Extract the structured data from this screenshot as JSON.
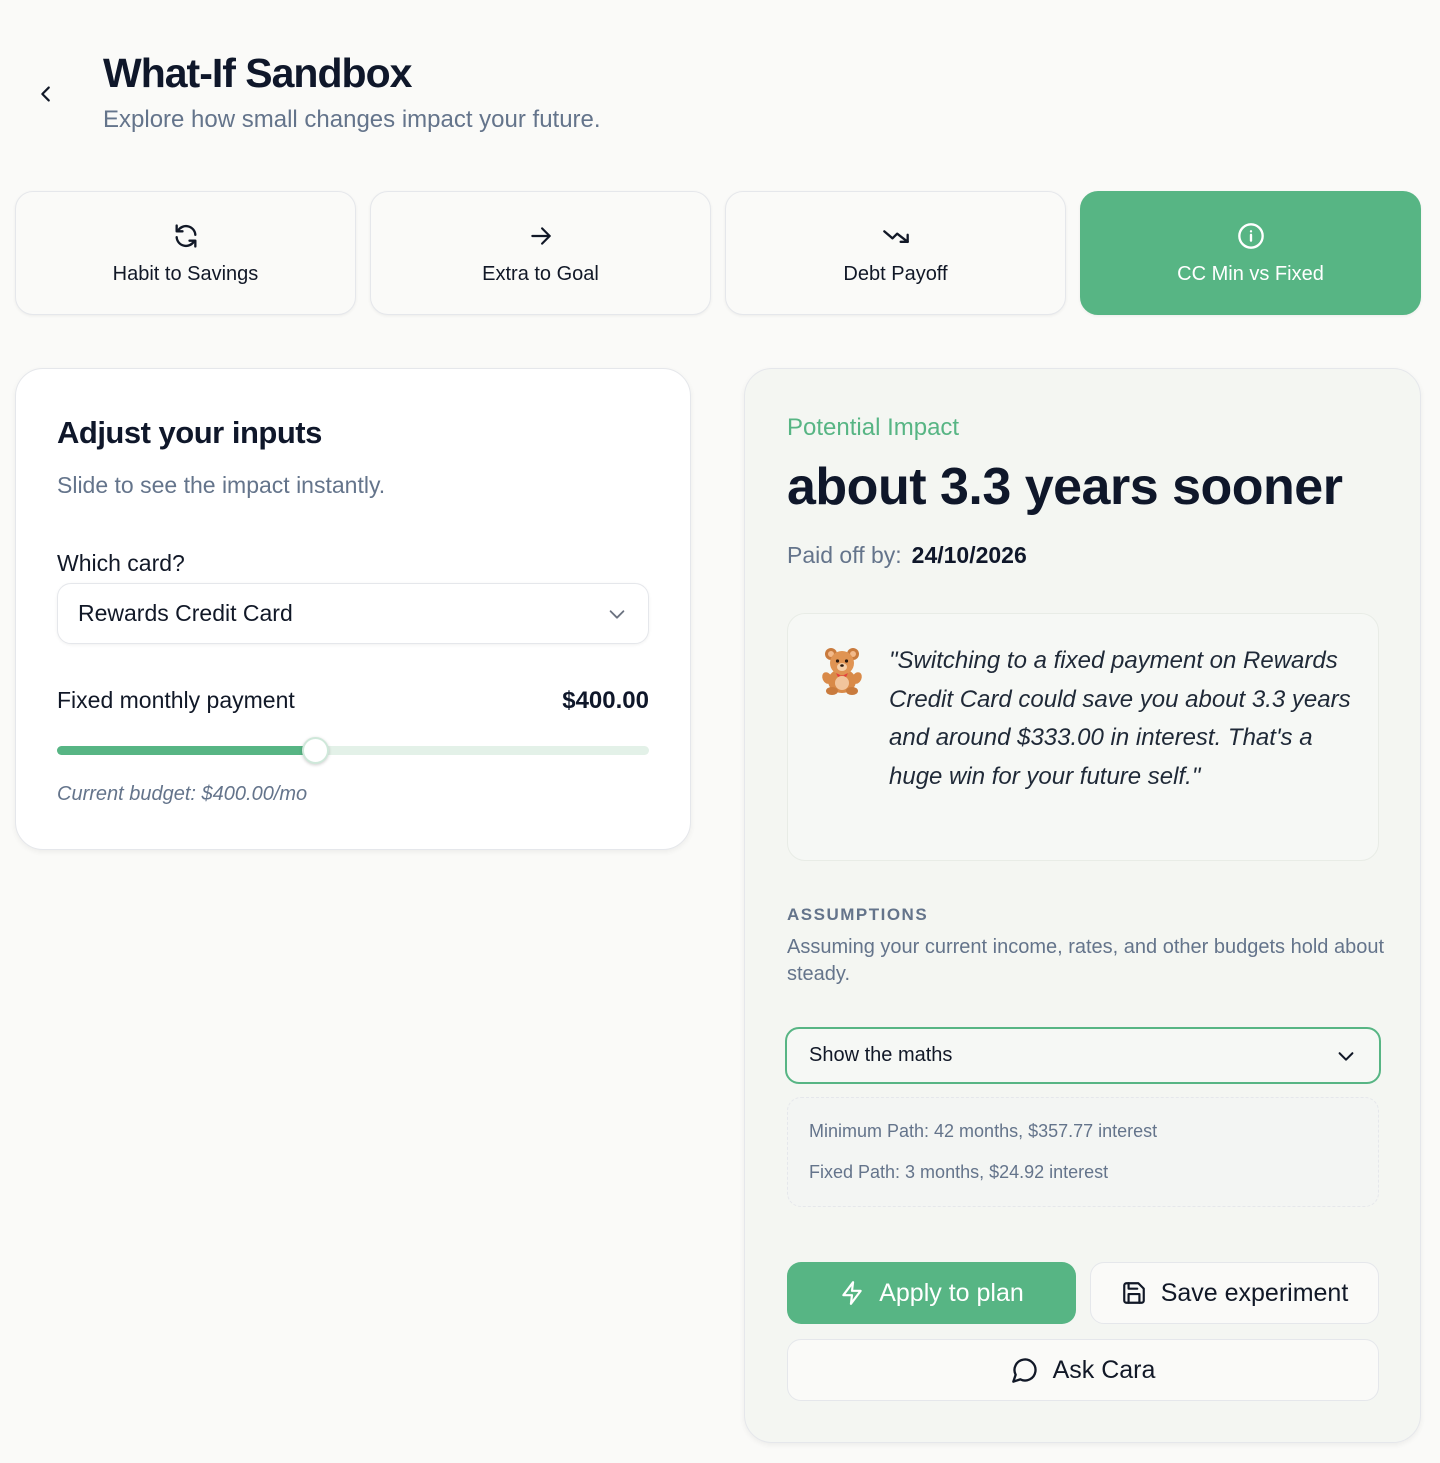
{
  "header": {
    "title": "What-If Sandbox",
    "subtitle": "Explore how small changes impact your future."
  },
  "tabs": [
    {
      "label": "Habit to Savings",
      "icon": "refresh-icon",
      "active": false
    },
    {
      "label": "Extra to Goal",
      "icon": "arrow-right-icon",
      "active": false
    },
    {
      "label": "Debt Payoff",
      "icon": "trending-down-icon",
      "active": false
    },
    {
      "label": "CC Min vs Fixed",
      "icon": "info-icon",
      "active": true
    }
  ],
  "inputs": {
    "title": "Adjust your inputs",
    "subtitle": "Slide to see the impact instantly.",
    "card_label": "Which card?",
    "card_value": "Rewards Credit Card",
    "payment_label": "Fixed monthly payment",
    "payment_value": "$400.00",
    "slider_fraction": 0.435,
    "budget_note": "Current budget: $400.00/mo"
  },
  "impact": {
    "eyebrow": "Potential Impact",
    "headline": "about 3.3 years sooner",
    "paid_label": "Paid off by:",
    "paid_date": "24/10/2026",
    "quote": "\"Switching to a fixed payment on Rewards Credit Card could save you about 3.3 years and around $333.00 in interest. That's a huge win for your future self.\"",
    "assumptions_label": "ASSUMPTIONS",
    "assumptions_text": "Assuming your current income, rates, and other budgets hold about steady.",
    "maths_toggle": "Show the maths",
    "maths_lines": [
      "Minimum Path: 42 months, $357.77 interest",
      "Fixed Path: 3 months, $24.92 interest"
    ]
  },
  "actions": {
    "apply": "Apply to plan",
    "save": "Save experiment",
    "ask": "Ask Cara"
  },
  "colors": {
    "accent": "#57b584",
    "background": "#fafaf8",
    "text_primary": "#0f172a",
    "text_muted": "#64748b"
  }
}
